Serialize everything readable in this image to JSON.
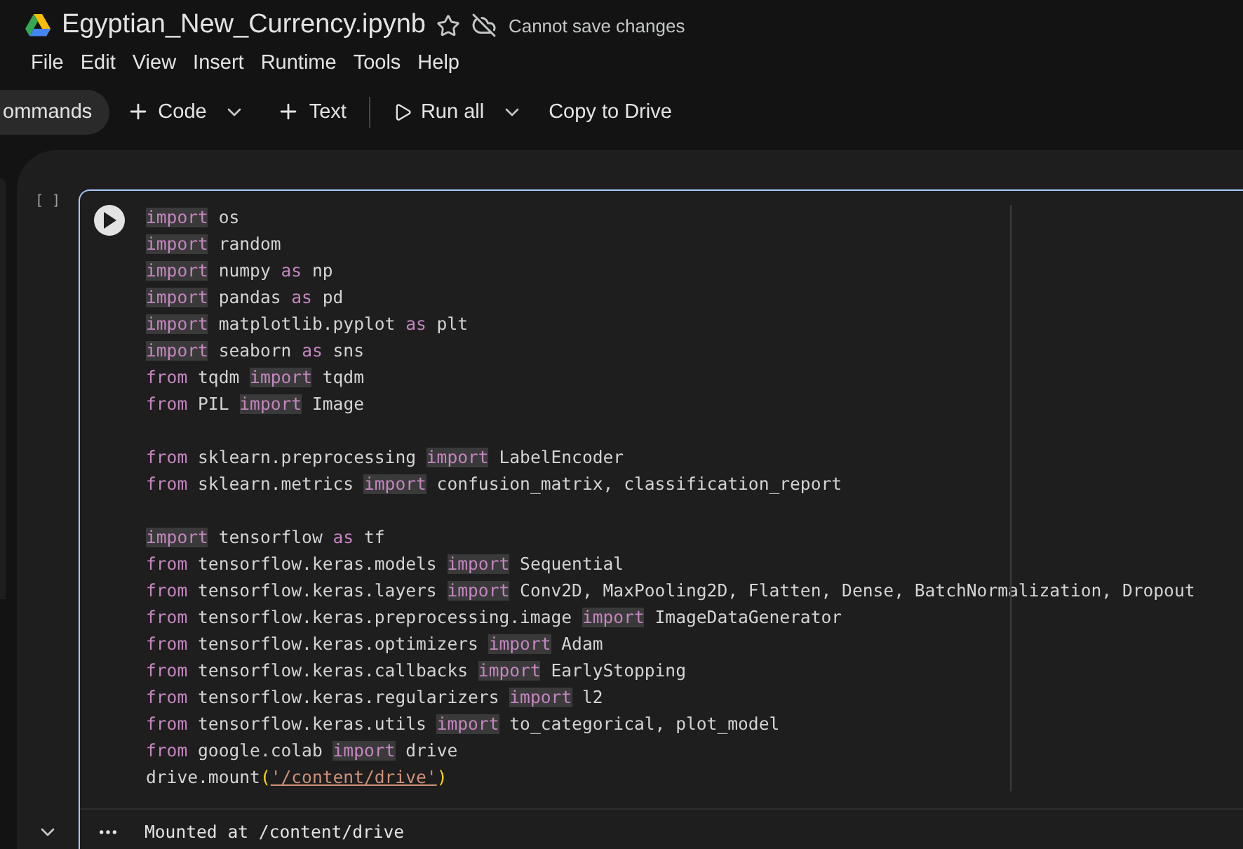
{
  "header": {
    "title": "Egyptian_New_Currency.ipynb",
    "starred": false,
    "save_status": "Cannot save changes"
  },
  "menu": [
    "File",
    "Edit",
    "View",
    "Insert",
    "Runtime",
    "Tools",
    "Help"
  ],
  "toolbar": {
    "commands": "ommands",
    "add_code": "Code",
    "add_text": "Text",
    "run_all": "Run all",
    "copy": "Copy to Drive"
  },
  "cell": {
    "exec_count": "[ ]",
    "lines": [
      [
        {
          "kind": "import",
          "text": "import"
        },
        {
          "kind": "plain",
          "text": " os"
        }
      ],
      [
        {
          "kind": "import",
          "text": "import"
        },
        {
          "kind": "plain",
          "text": " random"
        }
      ],
      [
        {
          "kind": "import",
          "text": "import"
        },
        {
          "kind": "plain",
          "text": " numpy "
        },
        {
          "kind": "keyword",
          "text": "as"
        },
        {
          "kind": "plain",
          "text": " np"
        }
      ],
      [
        {
          "kind": "import",
          "text": "import"
        },
        {
          "kind": "plain",
          "text": " pandas "
        },
        {
          "kind": "keyword",
          "text": "as"
        },
        {
          "kind": "plain",
          "text": " pd"
        }
      ],
      [
        {
          "kind": "import",
          "text": "import"
        },
        {
          "kind": "plain",
          "text": " matplotlib.pyplot "
        },
        {
          "kind": "keyword",
          "text": "as"
        },
        {
          "kind": "plain",
          "text": " plt"
        }
      ],
      [
        {
          "kind": "import",
          "text": "import"
        },
        {
          "kind": "plain",
          "text": " seaborn "
        },
        {
          "kind": "keyword",
          "text": "as"
        },
        {
          "kind": "plain",
          "text": " sns"
        }
      ],
      [
        {
          "kind": "keyword",
          "text": "from"
        },
        {
          "kind": "plain",
          "text": " tqdm "
        },
        {
          "kind": "import",
          "text": "import"
        },
        {
          "kind": "plain",
          "text": " tqdm"
        }
      ],
      [
        {
          "kind": "keyword",
          "text": "from"
        },
        {
          "kind": "plain",
          "text": " PIL "
        },
        {
          "kind": "import",
          "text": "import"
        },
        {
          "kind": "plain",
          "text": " Image"
        }
      ],
      [
        {
          "kind": "blank"
        }
      ],
      [
        {
          "kind": "keyword",
          "text": "from"
        },
        {
          "kind": "plain",
          "text": " sklearn.preprocessing "
        },
        {
          "kind": "import",
          "text": "import"
        },
        {
          "kind": "plain",
          "text": " LabelEncoder"
        }
      ],
      [
        {
          "kind": "keyword",
          "text": "from"
        },
        {
          "kind": "plain",
          "text": " sklearn.metrics "
        },
        {
          "kind": "import",
          "text": "import"
        },
        {
          "kind": "plain",
          "text": " confusion_matrix, classification_report"
        }
      ],
      [
        {
          "kind": "blank"
        }
      ],
      [
        {
          "kind": "import",
          "text": "import"
        },
        {
          "kind": "plain",
          "text": " tensorflow "
        },
        {
          "kind": "keyword",
          "text": "as"
        },
        {
          "kind": "plain",
          "text": " tf"
        }
      ],
      [
        {
          "kind": "keyword",
          "text": "from"
        },
        {
          "kind": "plain",
          "text": " tensorflow.keras.models "
        },
        {
          "kind": "import",
          "text": "import"
        },
        {
          "kind": "plain",
          "text": " Sequential"
        }
      ],
      [
        {
          "kind": "keyword",
          "text": "from"
        },
        {
          "kind": "plain",
          "text": " tensorflow.keras.layers "
        },
        {
          "kind": "import",
          "text": "import"
        },
        {
          "kind": "plain",
          "text": " Conv2D, MaxPooling2D, Flatten, Dense, BatchNormalization, Dropout"
        }
      ],
      [
        {
          "kind": "keyword",
          "text": "from"
        },
        {
          "kind": "plain",
          "text": " tensorflow.keras.preprocessing.image "
        },
        {
          "kind": "import",
          "text": "import"
        },
        {
          "kind": "plain",
          "text": " ImageDataGenerator"
        }
      ],
      [
        {
          "kind": "keyword",
          "text": "from"
        },
        {
          "kind": "plain",
          "text": " tensorflow.keras.optimizers "
        },
        {
          "kind": "import",
          "text": "import"
        },
        {
          "kind": "plain",
          "text": " Adam"
        }
      ],
      [
        {
          "kind": "keyword",
          "text": "from"
        },
        {
          "kind": "plain",
          "text": " tensorflow.keras.callbacks "
        },
        {
          "kind": "import",
          "text": "import"
        },
        {
          "kind": "plain",
          "text": " EarlyStopping"
        }
      ],
      [
        {
          "kind": "keyword",
          "text": "from"
        },
        {
          "kind": "plain",
          "text": " tensorflow.keras.regularizers "
        },
        {
          "kind": "import",
          "text": "import"
        },
        {
          "kind": "plain",
          "text": " l2"
        }
      ],
      [
        {
          "kind": "keyword",
          "text": "from"
        },
        {
          "kind": "plain",
          "text": " tensorflow.keras.utils "
        },
        {
          "kind": "import",
          "text": "import"
        },
        {
          "kind": "plain",
          "text": " to_categorical, plot_model"
        }
      ],
      [
        {
          "kind": "keyword",
          "text": "from"
        },
        {
          "kind": "plain",
          "text": " google.colab "
        },
        {
          "kind": "import",
          "text": "import"
        },
        {
          "kind": "plain",
          "text": " drive"
        }
      ],
      [
        {
          "kind": "plain",
          "text": "drive.mount"
        },
        {
          "kind": "bracket",
          "text": "("
        },
        {
          "kind": "string",
          "text": "'/content/drive'"
        },
        {
          "kind": "bracket",
          "text": ")"
        }
      ]
    ],
    "output": "Mounted at /content/drive"
  }
}
